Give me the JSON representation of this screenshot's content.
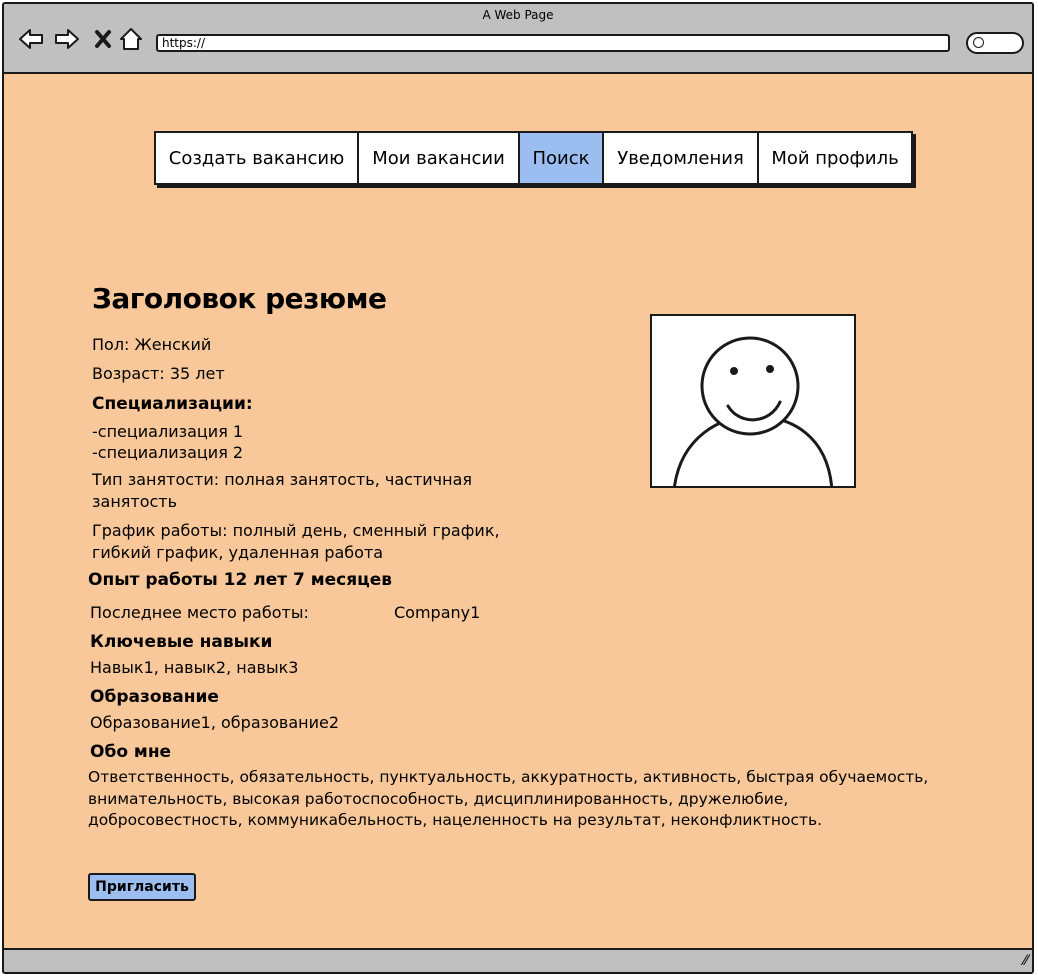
{
  "browser": {
    "window_title": "A Web Page",
    "url": "https://"
  },
  "nav": {
    "tabs": [
      {
        "label": "Создать вакансию",
        "active": false
      },
      {
        "label": "Мои вакансии",
        "active": false
      },
      {
        "label": "Поиск",
        "active": true
      },
      {
        "label": "Уведомления",
        "active": false
      },
      {
        "label": "Мой профиль",
        "active": false
      }
    ]
  },
  "resume": {
    "title": "Заголовок резюме",
    "gender": "Пол: Женский",
    "age": "Возраст: 35 лет",
    "specializations_heading": "Специализации:",
    "specializations": [
      "-специализация 1",
      "-специализация 2"
    ],
    "employment_type_line1": "Тип занятости: полная занятость, частичная",
    "employment_type_line2": "занятость",
    "schedule_line1": "График работы: полный день, сменный график,",
    "schedule_line2": "гибкий график, удаленная работа",
    "experience_heading": "Опыт работы 12 лет 7 месяцев",
    "last_job_label": "Последнее место работы:",
    "last_job_company": "Company1",
    "skills_heading": "Ключевые навыки",
    "skills": "Навык1, навык2, навык3",
    "education_heading": "Образование",
    "education": "Образование1, образование2",
    "about_heading": "Обо мне",
    "about_line1": "Ответственность, обязательность, пунктуальность, аккуратность, активность, быстрая обучаемость,",
    "about_line2": "внимательность, высокая работоспособность, дисциплинированность, дружелюбие,",
    "about_line3": "добросовестность, коммуникабельность, нацеленность на результат, неконфликтность."
  },
  "actions": {
    "invite_label": "Пригласить"
  },
  "colors": {
    "page_bg": "#f8c89a",
    "chrome_bg": "#c0c0c0",
    "active_tab": "#9bbdf0",
    "button_bg": "#9bbdf0"
  }
}
